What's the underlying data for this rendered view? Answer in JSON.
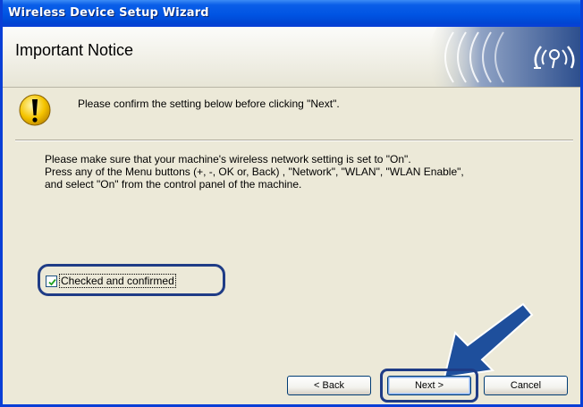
{
  "window": {
    "title": "Wireless Device Setup Wizard"
  },
  "header": {
    "title": "Important Notice",
    "logo_icon": "wireless-signal-logo"
  },
  "notice": {
    "icon": "warning-icon",
    "text": "Please confirm the setting below before clicking \"Next\"."
  },
  "body": {
    "lines": [
      "Please make sure that your machine's wireless network setting is set to \"On\".",
      "Press any of the Menu buttons (+, -, OK or, Back) , \"Network\", \"WLAN\", \"WLAN Enable\",",
      "and select \"On\" from the control panel of the machine."
    ]
  },
  "confirm": {
    "label": "Checked and confirmed",
    "checked": true
  },
  "buttons": {
    "back": "< Back",
    "next": "Next >",
    "cancel": "Cancel"
  },
  "colors": {
    "accent": "#0054e3",
    "highlight": "#1f3c86",
    "arrow": "#1e4f9c"
  }
}
